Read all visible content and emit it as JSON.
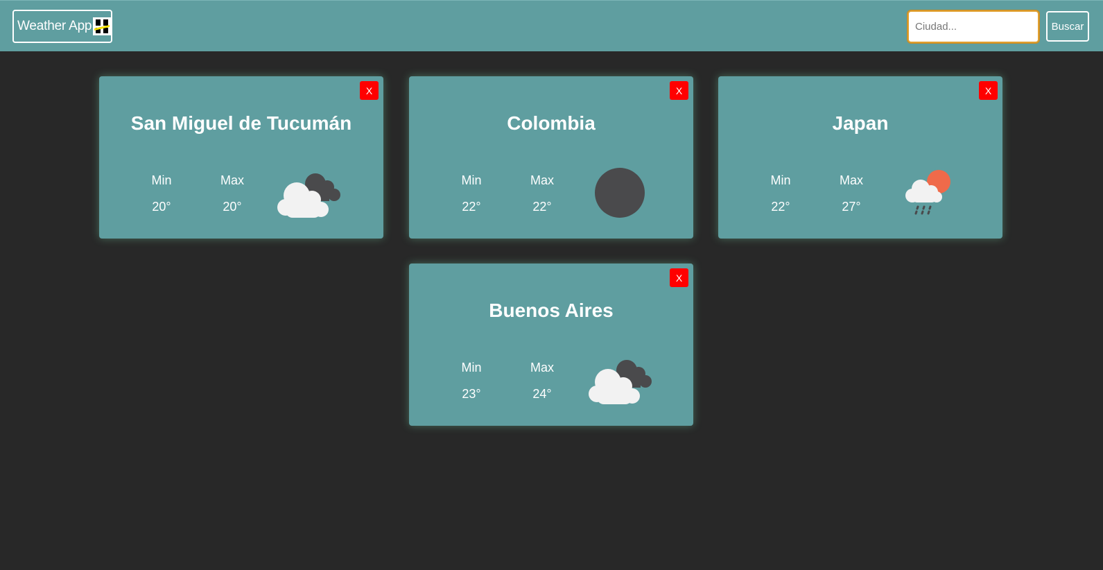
{
  "navbar": {
    "brand_title": "Weather App",
    "search": {
      "placeholder": "Ciudad...",
      "value": ""
    },
    "search_button": "Buscar"
  },
  "labels": {
    "min": "Min",
    "max": "Max",
    "close": "X"
  },
  "cards": [
    {
      "city": "San Miguel de Tucumán",
      "min": "20°",
      "max": "20°",
      "icon": "broken-clouds-icon"
    },
    {
      "city": "Colombia",
      "min": "22°",
      "max": "22°",
      "icon": "moon-icon"
    },
    {
      "city": "Japan",
      "min": "22°",
      "max": "27°",
      "icon": "rain-sun-icon"
    },
    {
      "city": "Buenos Aires",
      "min": "23°",
      "max": "24°",
      "icon": "broken-clouds-icon"
    }
  ],
  "colors": {
    "background": "#282828",
    "navbar": "#5f9ea0",
    "card": "#5f9ea0",
    "close_button": "#ff0000"
  }
}
